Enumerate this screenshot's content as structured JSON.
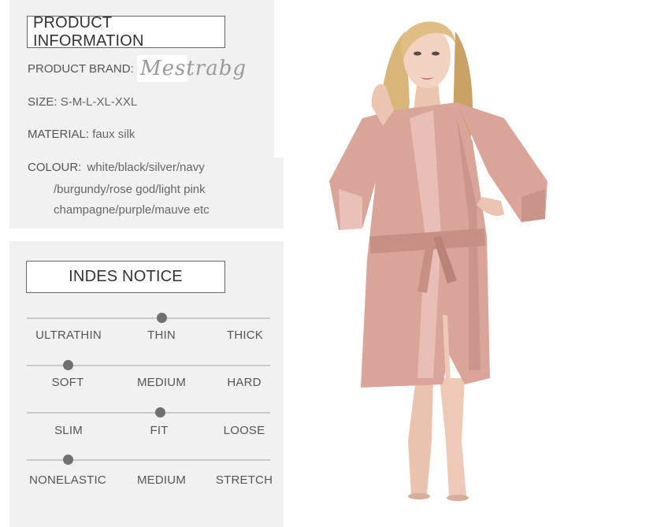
{
  "product_info": {
    "title": "PRODUCT INFORMATION",
    "brand_label": "PRODUCT BRAND:",
    "brand_value": "Mestrabg",
    "size_label": "SIZE:",
    "size_value": "S-M-L-XL-XXL",
    "material_label": "MATERIAL:",
    "material_value": "faux silk",
    "colour_label": "COLOUR:",
    "colour_line1": "white/black/silver/navy",
    "colour_line2": "/burgundy/rose god/light pink",
    "colour_line3": "champagne/purple/mauve etc"
  },
  "notice": {
    "title": "INDES NOTICE",
    "scales": [
      {
        "labels": [
          "ULTRATHIN",
          "THIN",
          "THICK"
        ],
        "selected_index": 1
      },
      {
        "labels": [
          "SOFT",
          "MEDIUM",
          "HARD"
        ],
        "selected_index": 0
      },
      {
        "labels": [
          "SLIM",
          "FIT",
          "LOOSE"
        ],
        "selected_index": 1
      },
      {
        "labels": [
          "NONELASTIC",
          "MEDIUM",
          "STRETCH"
        ],
        "selected_index": 0
      }
    ]
  },
  "colors": {
    "robe": "#d9a49a",
    "robe_shadow": "#b9837a",
    "robe_highlight": "#f0cdc4",
    "panel": "#f1f1f1"
  }
}
